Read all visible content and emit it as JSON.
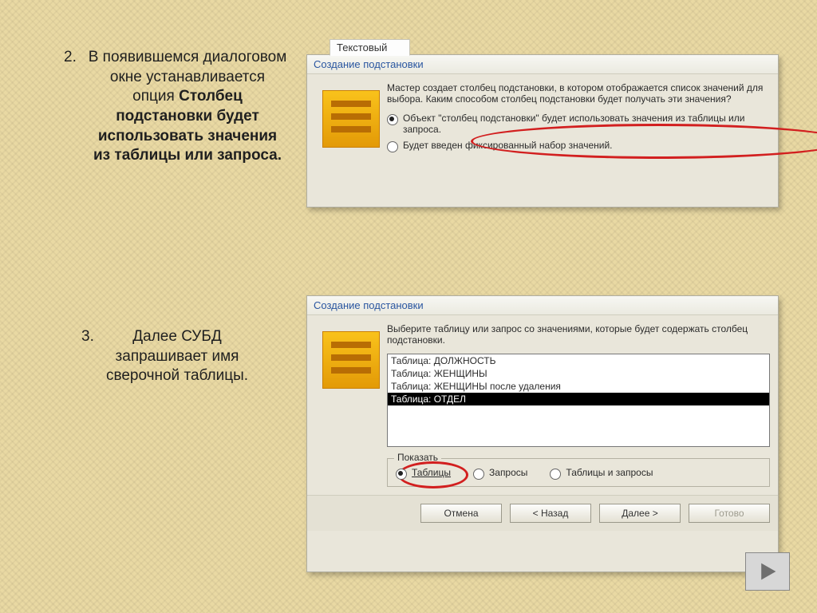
{
  "bullets": {
    "b2": {
      "num": "2.",
      "text_before": "В появившемся диалоговом окне устанавливается опция ",
      "bold": "Столбец подстановки будет использовать значения из таблицы или запроса."
    },
    "b3": {
      "num": "3.",
      "text": "Далее СУБД запрашивает имя сверочной таблицы."
    }
  },
  "dialog1": {
    "tab": "Текстовый",
    "title": "Создание подстановки",
    "desc": "Мастер создает столбец подстановки, в котором отображается список значений для выбора.  Каким способом столбец подстановки будет получать эти значения?",
    "opt1": "Объект \"столбец подстановки\" будет использовать значения из таблицы или запроса.",
    "opt2": "Будет введен фиксированный набор значений."
  },
  "dialog2": {
    "title": "Создание подстановки",
    "desc": "Выберите таблицу или запрос со значениями, которые будет содержать столбец подстановки.",
    "list": {
      "i0": "Таблица: ДОЛЖНОСТЬ",
      "i1": "Таблица: ЖЕНЩИНЫ",
      "i2": "Таблица: ЖЕНЩИНЫ после удаления",
      "i3": "Таблица: ОТДЕЛ"
    },
    "group_label": "Показать",
    "show": {
      "tables": "Таблицы",
      "queries": "Запросы",
      "both": "Таблицы и запросы"
    },
    "buttons": {
      "cancel": "Отмена",
      "back": "< Назад",
      "next": "Далее >",
      "finish": "Готово"
    }
  }
}
